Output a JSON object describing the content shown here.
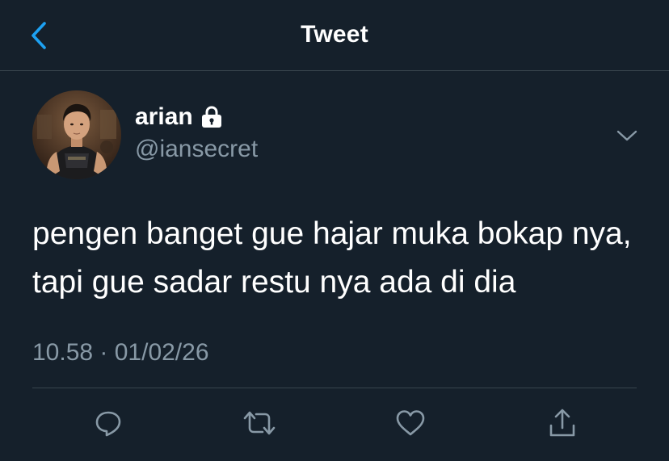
{
  "header": {
    "title": "Tweet",
    "back_icon": "chevron-left-icon"
  },
  "tweet": {
    "author": {
      "display_name": "arian",
      "handle": "@iansecret",
      "protected_icon": "lock-icon"
    },
    "text": "pengen banget gue hajar muka bokap nya, tapi gue sadar restu nya ada di dia",
    "timestamp": "10.58 · 01/02/26",
    "more_icon": "chevron-down-icon"
  },
  "actions": [
    {
      "icon": "reply-icon"
    },
    {
      "icon": "retweet-icon"
    },
    {
      "icon": "like-icon"
    },
    {
      "icon": "share-icon"
    }
  ],
  "colors": {
    "background": "#15202b",
    "accent": "#1da1f2",
    "secondary_text": "#8899a6",
    "divider": "#38444d"
  }
}
